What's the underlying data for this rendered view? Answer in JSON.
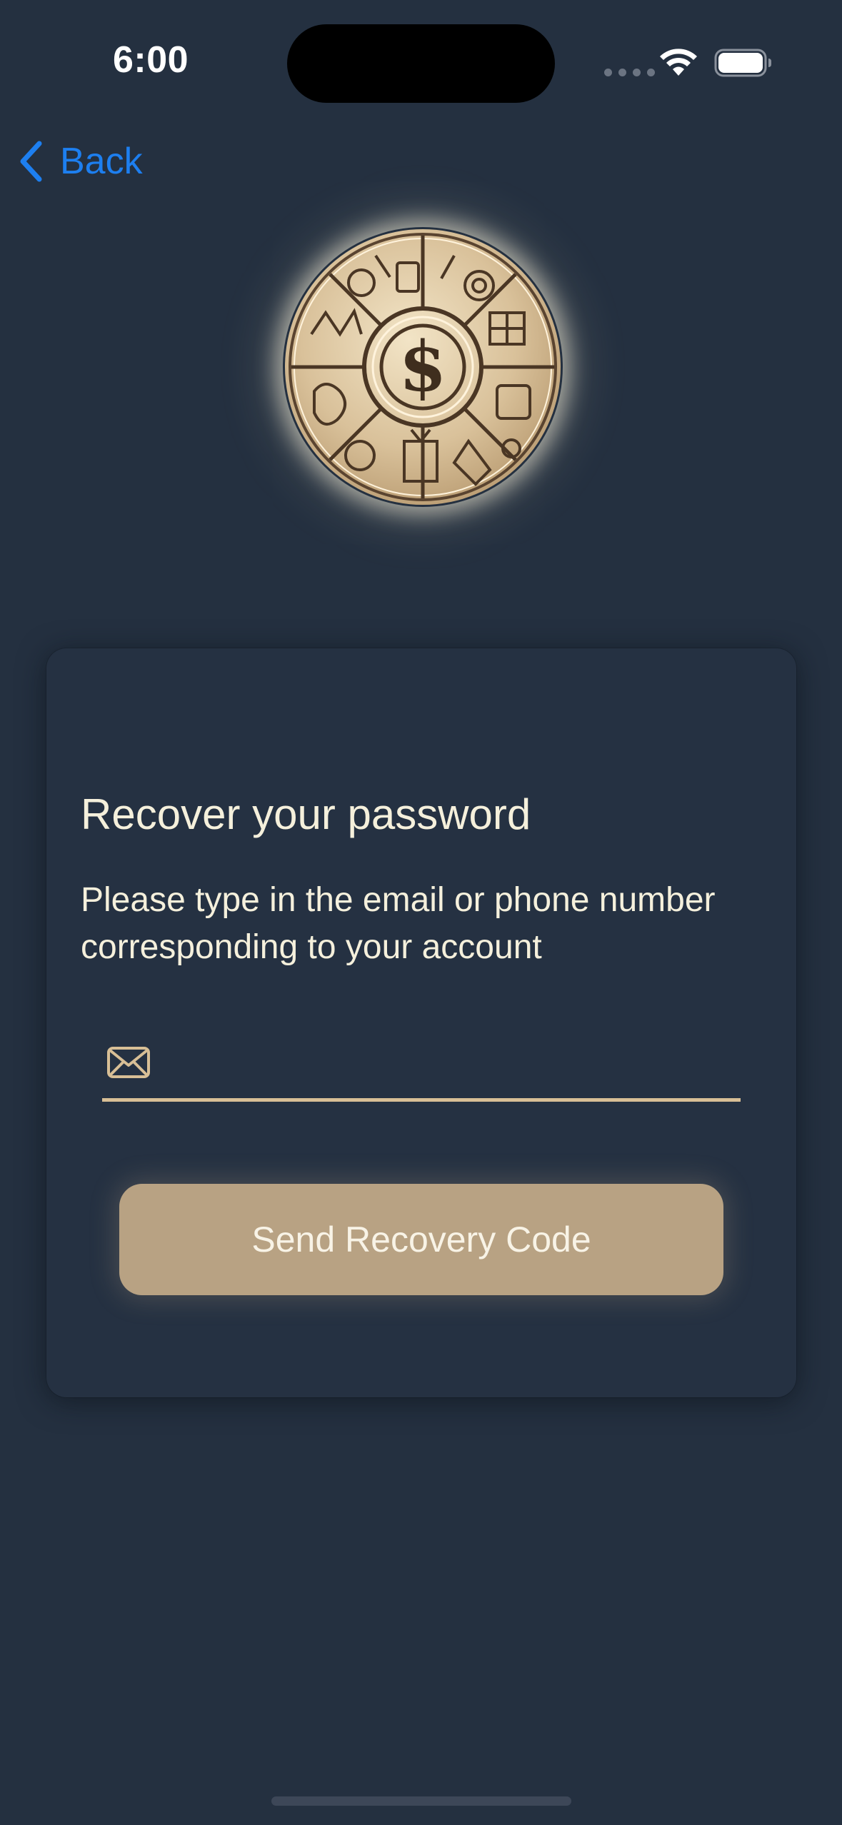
{
  "status_bar": {
    "time": "6:00",
    "icons": [
      "cellular-dots-icon",
      "wifi-icon",
      "battery-icon"
    ]
  },
  "nav": {
    "back_label": "Back",
    "back_icon": "chevron-left-icon"
  },
  "logo": {
    "icon": "coin-emblem-icon",
    "symbol": "$"
  },
  "card": {
    "title": "Recover your password",
    "description": "Please type in the email or phone number corresponding to your account",
    "input": {
      "icon": "mail-icon",
      "value": "",
      "placeholder": ""
    },
    "submit_label": "Send Recovery Code"
  },
  "colors": {
    "background": "#243040",
    "card": "#253142",
    "accent": "#b8a283",
    "underline": "#d8bf96",
    "text": "#f5f0dc",
    "link": "#1d7ff0"
  }
}
